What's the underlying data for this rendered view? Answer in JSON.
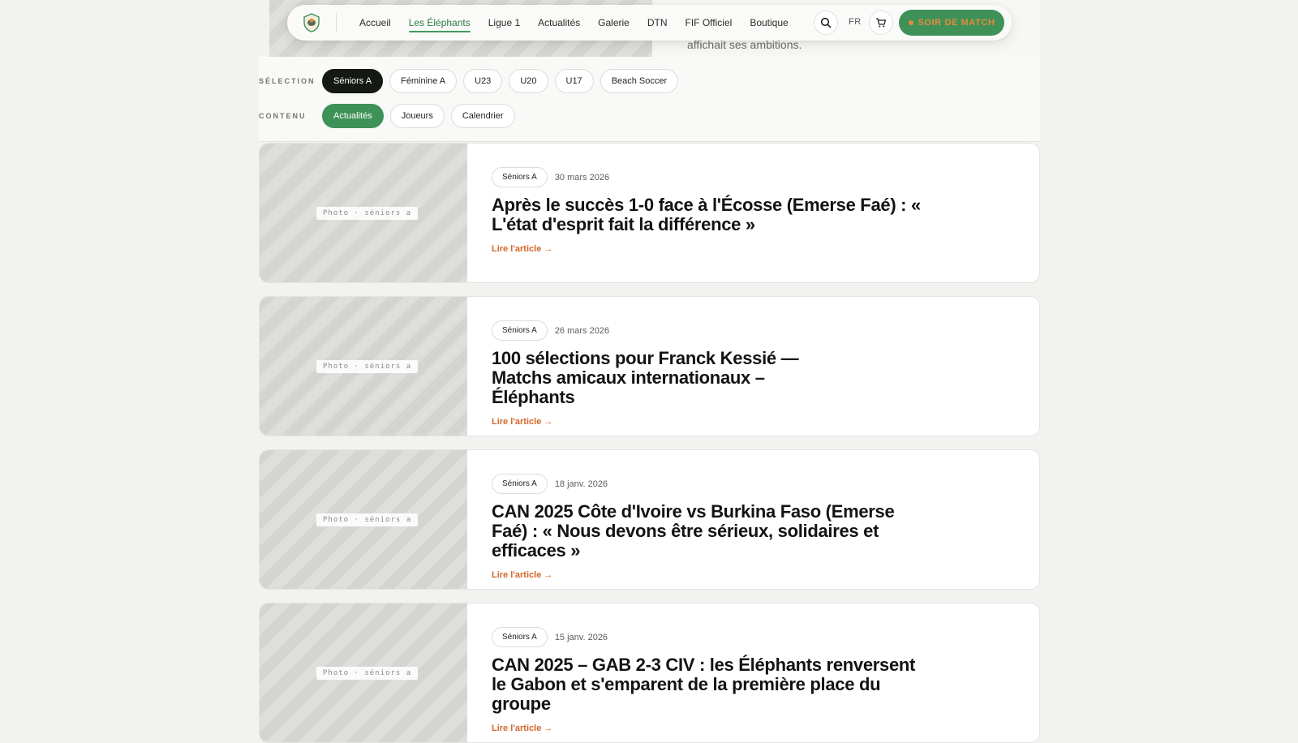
{
  "background": {
    "hero_text": "affichait ses ambitions."
  },
  "navbar": {
    "links": [
      "Accueil",
      "Les Éléphants",
      "Ligue 1",
      "Actualités",
      "Galerie",
      "DTN",
      "FIF Officiel",
      "Boutique"
    ],
    "active_link": "Les Éléphants",
    "language": "FR",
    "cta_label": "SOIR DE MATCH"
  },
  "filters": {
    "selection_label": "SÉLECTION",
    "selection_options": [
      "Séniors A",
      "Féminine A",
      "U23",
      "U20",
      "U17",
      "Beach Soccer"
    ],
    "selection_active": "Séniors A",
    "content_label": "CONTENU",
    "content_options": [
      "Actualités",
      "Joueurs",
      "Calendrier"
    ],
    "content_active": "Actualités"
  },
  "articles": [
    {
      "image_label": "Photo · séniors a",
      "category": "Séniors A",
      "date": "30 mars 2026",
      "title": "Après le succès 1-0 face à l'Écosse (Emerse Faé) : « L'état d'esprit fait la différence »",
      "link_label": "Lire l'article →"
    },
    {
      "image_label": "Photo · séniors a",
      "category": "Séniors A",
      "date": "26 mars 2026",
      "title": "100 sélections pour Franck Kessié — Matchs amicaux internationaux – Éléphants",
      "link_label": "Lire l'article →"
    },
    {
      "image_label": "Photo · séniors a",
      "category": "Séniors A",
      "date": "18 janv. 2026",
      "title": "CAN 2025 Côte d'Ivoire vs Burkina Faso (Emerse Faé) : « Nous devons être sérieux, solidaires et efficaces »",
      "link_label": "Lire l'article →"
    },
    {
      "image_label": "Photo · séniors a",
      "category": "Séniors A",
      "date": "15 janv. 2026",
      "title": "CAN 2025 – GAB 2-3 CIV : les Éléphants renversent le Gabon et s'emparent de la première place du groupe",
      "link_label": "Lire l'article →"
    }
  ],
  "colors": {
    "brand_green": "#3e9258",
    "accent_orange": "#d4672a",
    "dark_pill": "#151915"
  }
}
